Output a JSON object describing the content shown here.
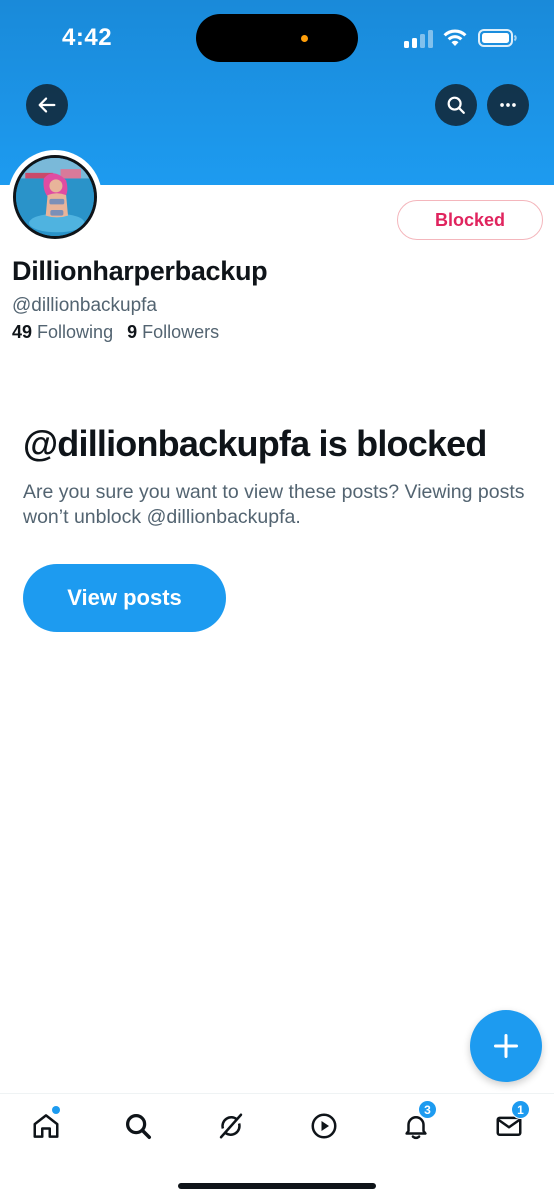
{
  "status_bar": {
    "time": "4:42"
  },
  "header": {
    "back_icon": "arrow-left-icon",
    "search_icon": "search-icon",
    "more_icon": "more-horizontal-icon"
  },
  "profile": {
    "display_name": "Dillionharperbackup",
    "handle": "@dillionbackupfa",
    "following_count": "49",
    "following_label": "Following",
    "followers_count": "9",
    "followers_label": "Followers",
    "blocked_button_label": "Blocked"
  },
  "blocked_notice": {
    "title": "@dillionbackupfa is blocked",
    "description": "Are you sure you want to view these posts? Viewing posts won’t unblock @dillionbackupfa.",
    "view_button_label": "View posts"
  },
  "tab_bar": {
    "items": [
      {
        "icon": "home-icon",
        "badge": ""
      },
      {
        "icon": "search-icon",
        "badge": ""
      },
      {
        "icon": "grok-icon",
        "badge": ""
      },
      {
        "icon": "video-play-icon",
        "badge": ""
      },
      {
        "icon": "bell-icon",
        "badge": "3"
      },
      {
        "icon": "mail-icon",
        "badge": "1"
      }
    ]
  },
  "colors": {
    "accent": "#1d9bf0",
    "blocked_red": "#e0245e",
    "text_primary": "#0f1419",
    "text_secondary": "#536471"
  }
}
